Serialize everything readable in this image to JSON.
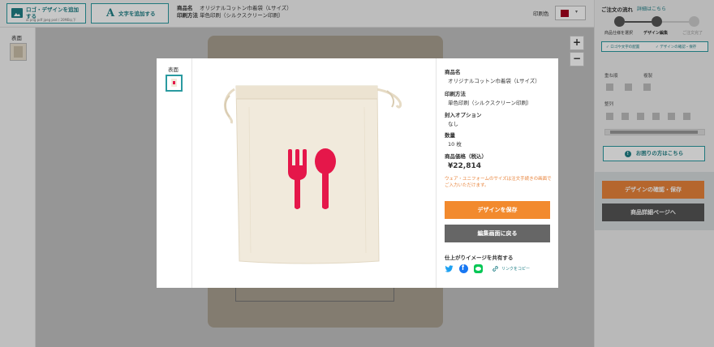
{
  "toolbar": {
    "add_logo_label": "ロゴ・デザインを追加する",
    "add_logo_formats": "ai png pdf jpeg psd / 20MB以下",
    "add_text_label": "文字を追加する",
    "product_name_label": "商品名",
    "product_name_value": "オリジナルコットン巾着袋（Lサイズ）",
    "print_method_label": "印刷方法",
    "print_method_value": "単色印刷（シルクスクリーン印刷）",
    "print_color_label": "印刷色",
    "print_color_swatch": "#a3001e"
  },
  "left_panel": {
    "side_label": "表面"
  },
  "zoom": {
    "plus": "+",
    "minus": "−"
  },
  "right_panel": {
    "title": "ご注文の流れ",
    "link": "詳細はこちら",
    "steps": [
      "商品仕様を選択",
      "デザイン編集",
      "ご注文完了"
    ],
    "checks": [
      "✓ ロゴや文字の配置",
      "✓ デザインの確認・保存"
    ],
    "section_order": "重ね順",
    "section_copy": "複製",
    "section_align": "整列",
    "help_button": "お困りの方はこちら",
    "save_button": "デザインの確認・保存",
    "detail_button": "商品詳細ページへ"
  },
  "modal": {
    "side_label": "表面",
    "fields": [
      {
        "label": "商品名",
        "value": "オリジナルコットン巾着袋（Lサイズ）"
      },
      {
        "label": "印刷方法",
        "value": "単色印刷（シルクスクリーン印刷）"
      },
      {
        "label": "封入オプション",
        "value": "なし"
      },
      {
        "label": "数量",
        "value": "10 枚"
      }
    ],
    "price_label": "商品価格（税込）",
    "price_value": "¥22,814",
    "note": "ウェア・ユニフォームのサイズは注文手続きの画面でご入力いただけます。",
    "save_button": "デザインを保存",
    "back_button": "編集画面に戻る",
    "share_label": "仕上がりイメージを共有する",
    "copy_link": "リンクをコピー",
    "design_color": "#e5174a",
    "bag_color": "#f1eadc"
  }
}
